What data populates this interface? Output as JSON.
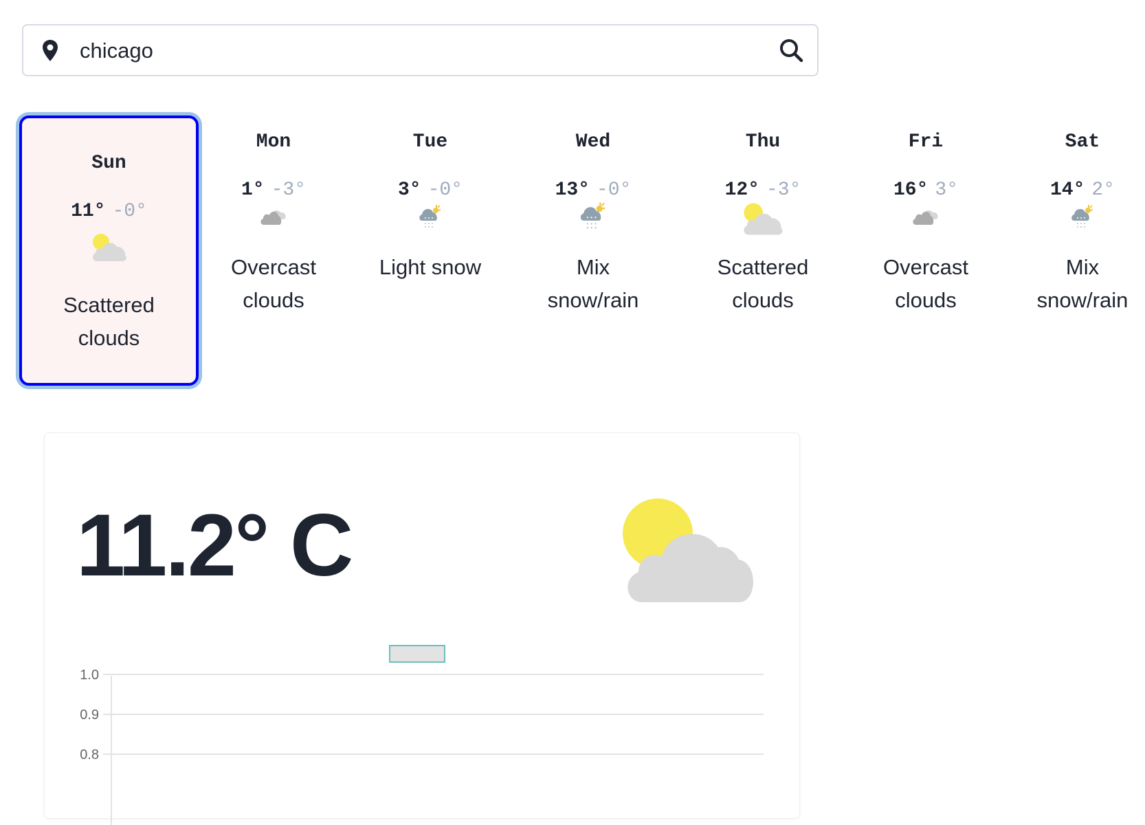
{
  "search": {
    "value": "chicago",
    "placeholder": "",
    "pin_icon": "map-pin-icon",
    "search_icon": "magnifier-icon"
  },
  "days": [
    {
      "name": "Sun",
      "high": "11°",
      "low": "-0°",
      "icon": "sun-cloud",
      "desc1": "Scattered",
      "desc2": "clouds",
      "selected": true
    },
    {
      "name": "Mon",
      "high": "1°",
      "low": "-3°",
      "icon": "overcast",
      "desc1": "Overcast",
      "desc2": "clouds"
    },
    {
      "name": "Tue",
      "high": "3°",
      "low": "-0°",
      "icon": "snow",
      "desc1": "Light snow",
      "desc2": ""
    },
    {
      "name": "Wed",
      "high": "13°",
      "low": "-0°",
      "icon": "snow",
      "desc1": "Mix",
      "desc2": "snow/rain"
    },
    {
      "name": "Thu",
      "high": "12°",
      "low": "-3°",
      "icon": "sun-cloud",
      "desc1": "Scattered",
      "desc2": "clouds"
    },
    {
      "name": "Fri",
      "high": "16°",
      "low": "3°",
      "icon": "overcast",
      "desc1": "Overcast",
      "desc2": "clouds"
    },
    {
      "name": "Sat",
      "high": "14°",
      "low": "2°",
      "icon": "snow",
      "desc1": "Mix",
      "desc2": "snow/rain"
    }
  ],
  "current": {
    "temperature": "11.2° C",
    "icon": "sun-cloud"
  },
  "chart_data": {
    "type": "line",
    "series": [
      {
        "name": "",
        "values": []
      }
    ],
    "yticks": [
      "1.0",
      "0.9",
      "0.8"
    ],
    "ylim": [
      0.8,
      1.0
    ],
    "grid": true,
    "legend": "top-center",
    "legend_color": "#6bbfbf"
  }
}
